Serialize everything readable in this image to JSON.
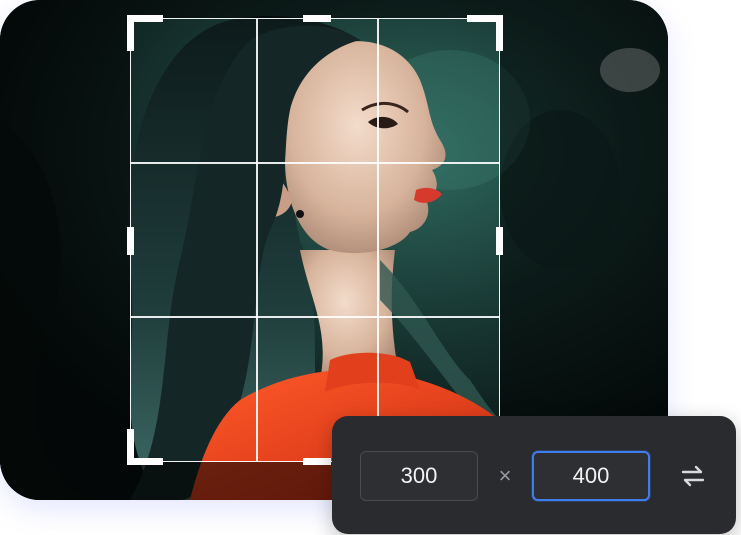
{
  "crop_tool": {
    "photo_subject": "woman-profile-portrait",
    "grid": "rule-of-thirds",
    "crop_frame_color": "#ffffff"
  },
  "size_panel": {
    "width_value": "300",
    "height_value": "400",
    "times_symbol": "×",
    "swap_icon": "swap-arrows-icon",
    "focus_color": "#3f7cf0",
    "panel_color": "#2a2b2e"
  }
}
